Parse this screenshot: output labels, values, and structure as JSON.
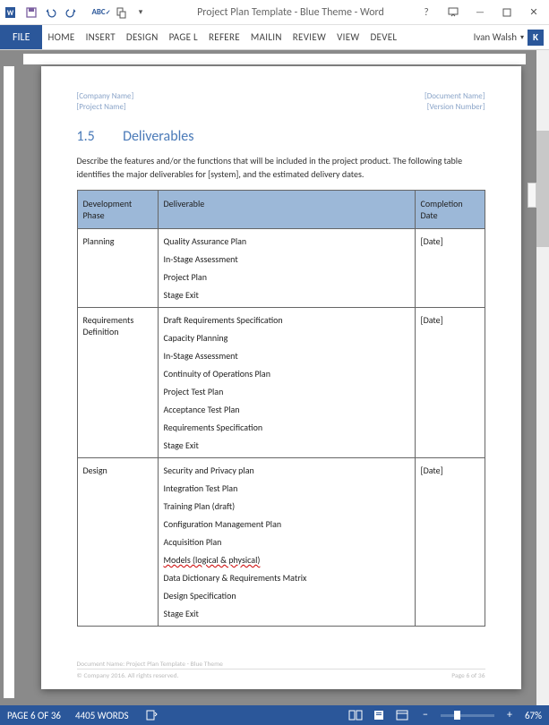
{
  "titlebar": {
    "title": "Project Plan Template - Blue Theme - Word"
  },
  "ribbon": {
    "file": "FILE",
    "tabs": [
      "HOME",
      "INSERT",
      "DESIGN",
      "PAGE L",
      "REFERE",
      "MAILIN",
      "REVIEW",
      "VIEW",
      "DEVEL"
    ],
    "user": "Ivan Walsh",
    "user_initial": "K"
  },
  "doc": {
    "header": {
      "company": "[Company Name]",
      "project": "[Project Name]",
      "docname": "[Document Name]",
      "version": "[Version Number]"
    },
    "section": {
      "num": "1.5",
      "title": "Deliverables",
      "desc": "Describe the features and/or the functions that will be included in the project product. The following table identifies the major deliverables for [system], and the estimated delivery dates."
    },
    "table": {
      "headers": {
        "phase": "Development Phase",
        "deliv": "Deliverable",
        "date": "Completion Date"
      },
      "rows": [
        {
          "phase": "Planning",
          "date": "[Date]",
          "delivs": [
            "Quality Assurance Plan",
            "In-Stage Assessment",
            "Project Plan",
            "Stage Exit"
          ]
        },
        {
          "phase": "Requirements Definition",
          "date": "[Date]",
          "delivs": [
            "Draft Requirements Specification",
            "Capacity Planning",
            "In-Stage Assessment",
            "Continuity of Operations Plan",
            "Project Test Plan",
            "Acceptance Test Plan",
            "Requirements Specification",
            "Stage Exit"
          ]
        },
        {
          "phase": "Design",
          "date": "[Date]",
          "delivs": [
            "Security and Privacy plan",
            "Integration Test Plan",
            "Training Plan (draft)",
            "Configuration Management Plan",
            "Acquisition Plan",
            "Models (logical & physical)",
            "Data Dictionary & Requirements Matrix",
            "Design Specification",
            "Stage Exit"
          ],
          "err_index": 5
        }
      ]
    },
    "footer": {
      "docname": "Document Name: Project Plan Template - Blue Theme",
      "copyright": "© Company 2016. All rights reserved.",
      "page": "Page 6 of 36"
    }
  },
  "statusbar": {
    "page": "PAGE 6 OF 36",
    "words": "4405 WORDS",
    "zoom": "67%"
  }
}
